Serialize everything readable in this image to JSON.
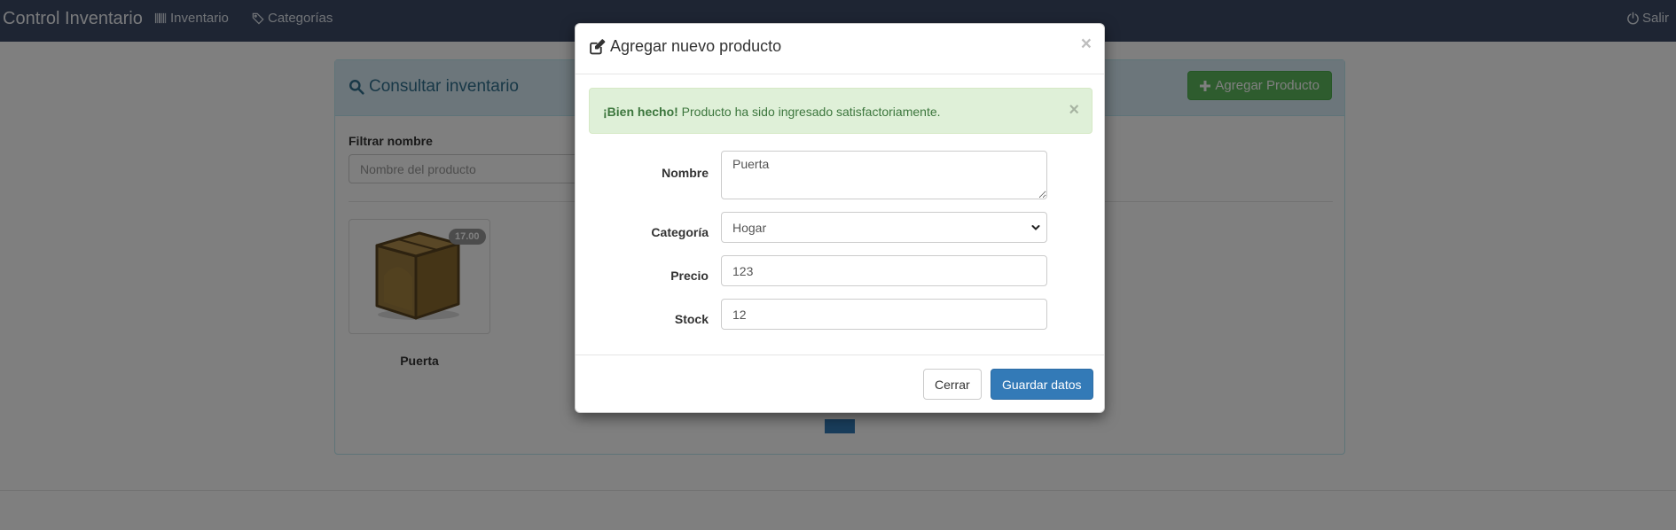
{
  "navbar": {
    "brand": "Control Inventario",
    "items": [
      {
        "label": "Inventario",
        "icon": "barcode-icon"
      },
      {
        "label": "Categorías",
        "icon": "tags-icon"
      }
    ],
    "logout": {
      "label": "Salir",
      "icon": "power-icon"
    }
  },
  "panel": {
    "title": "Consultar inventario",
    "title_icon": "search-icon",
    "add_button": "Agregar Producto",
    "filter_label": "Filtrar nombre",
    "filter_placeholder": "Nombre del producto",
    "products": [
      {
        "name": "Puerta",
        "price_badge": "17.00",
        "image_icon": "box-icon"
      }
    ]
  },
  "modal": {
    "title": "Agregar nuevo producto",
    "title_icon": "edit-icon",
    "close_glyph": "×",
    "alert": {
      "strong": "¡Bien hecho!",
      "message": "Producto ha sido ingresado satisfactoriamente.",
      "close_glyph": "×"
    },
    "fields": {
      "nombre": {
        "label": "Nombre",
        "value": "Puerta"
      },
      "categoria": {
        "label": "Categoría",
        "value": "Hogar"
      },
      "precio": {
        "label": "Precio",
        "value": "123"
      },
      "stock": {
        "label": "Stock",
        "value": "12"
      }
    },
    "buttons": {
      "close": "Cerrar",
      "save": "Guardar datos"
    }
  },
  "colors": {
    "navbar": "#3c4a66",
    "panel_heading": "#d9edf7",
    "success": "#5cb85c",
    "primary": "#337ab7",
    "alert_bg": "#dff0d8",
    "alert_text": "#3c763d"
  }
}
